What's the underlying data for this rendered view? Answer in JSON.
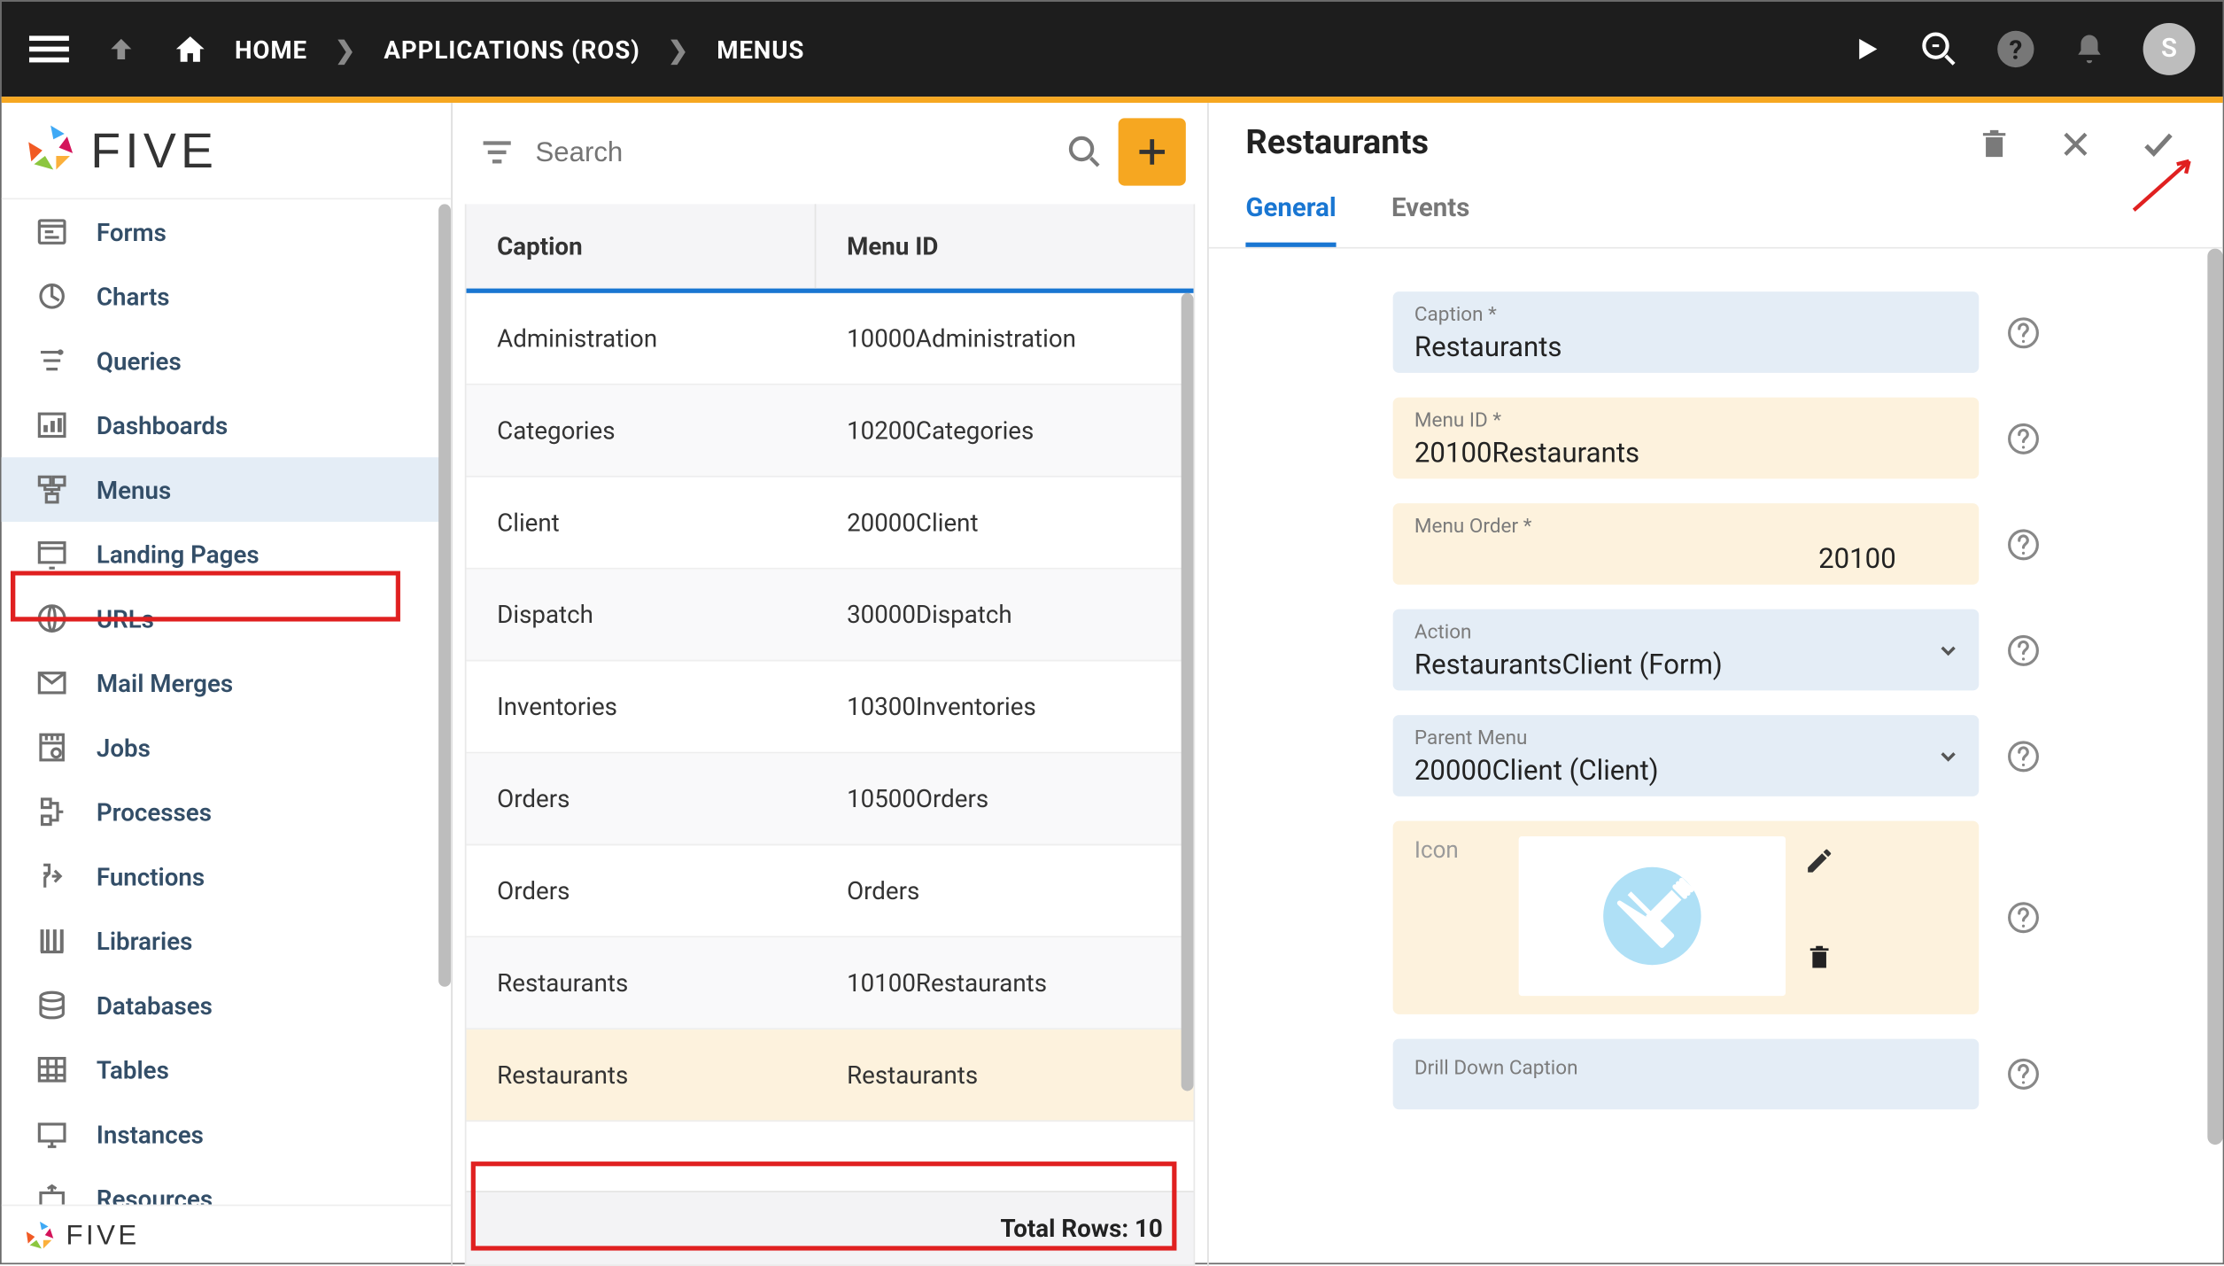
{
  "breadcrumb": {
    "home": "HOME",
    "apps": "APPLICATIONS (ROS)",
    "menus": "MENUS"
  },
  "avatar_initial": "S",
  "logo_text": "FIVE",
  "sidebar": {
    "items": [
      {
        "label": "Forms"
      },
      {
        "label": "Charts"
      },
      {
        "label": "Queries"
      },
      {
        "label": "Dashboards"
      },
      {
        "label": "Menus",
        "active": true
      },
      {
        "label": "Landing Pages"
      },
      {
        "label": "URLs"
      },
      {
        "label": "Mail Merges"
      },
      {
        "label": "Jobs"
      },
      {
        "label": "Processes"
      },
      {
        "label": "Functions"
      },
      {
        "label": "Libraries"
      },
      {
        "label": "Databases"
      },
      {
        "label": "Tables"
      },
      {
        "label": "Instances"
      },
      {
        "label": "Resources"
      }
    ]
  },
  "list": {
    "search_placeholder": "Search",
    "headers": {
      "caption": "Caption",
      "menu_id": "Menu ID"
    },
    "rows": [
      {
        "caption": "Administration",
        "menu_id": "10000Administration"
      },
      {
        "caption": "Categories",
        "menu_id": "10200Categories"
      },
      {
        "caption": "Client",
        "menu_id": "20000Client"
      },
      {
        "caption": "Dispatch",
        "menu_id": "30000Dispatch"
      },
      {
        "caption": "Inventories",
        "menu_id": "10300Inventories"
      },
      {
        "caption": "Orders",
        "menu_id": "10500Orders"
      },
      {
        "caption": "Orders",
        "menu_id": "Orders"
      },
      {
        "caption": "Restaurants",
        "menu_id": "10100Restaurants"
      },
      {
        "caption": "Restaurants",
        "menu_id": "Restaurants",
        "selected": true
      }
    ],
    "total_label": "Total Rows: 10"
  },
  "detail": {
    "title": "Restaurants",
    "tabs": {
      "general": "General",
      "events": "Events"
    },
    "fields": {
      "caption_label": "Caption *",
      "caption_value": "Restaurants",
      "menuid_label": "Menu ID *",
      "menuid_value": "20100Restaurants",
      "order_label": "Menu Order *",
      "order_value": "20100",
      "action_label": "Action",
      "action_value": "RestaurantsClient (Form)",
      "parent_label": "Parent Menu",
      "parent_value": "20000Client (Client)",
      "icon_label": "Icon",
      "drill_label": "Drill Down Caption",
      "drill_value": ""
    }
  }
}
